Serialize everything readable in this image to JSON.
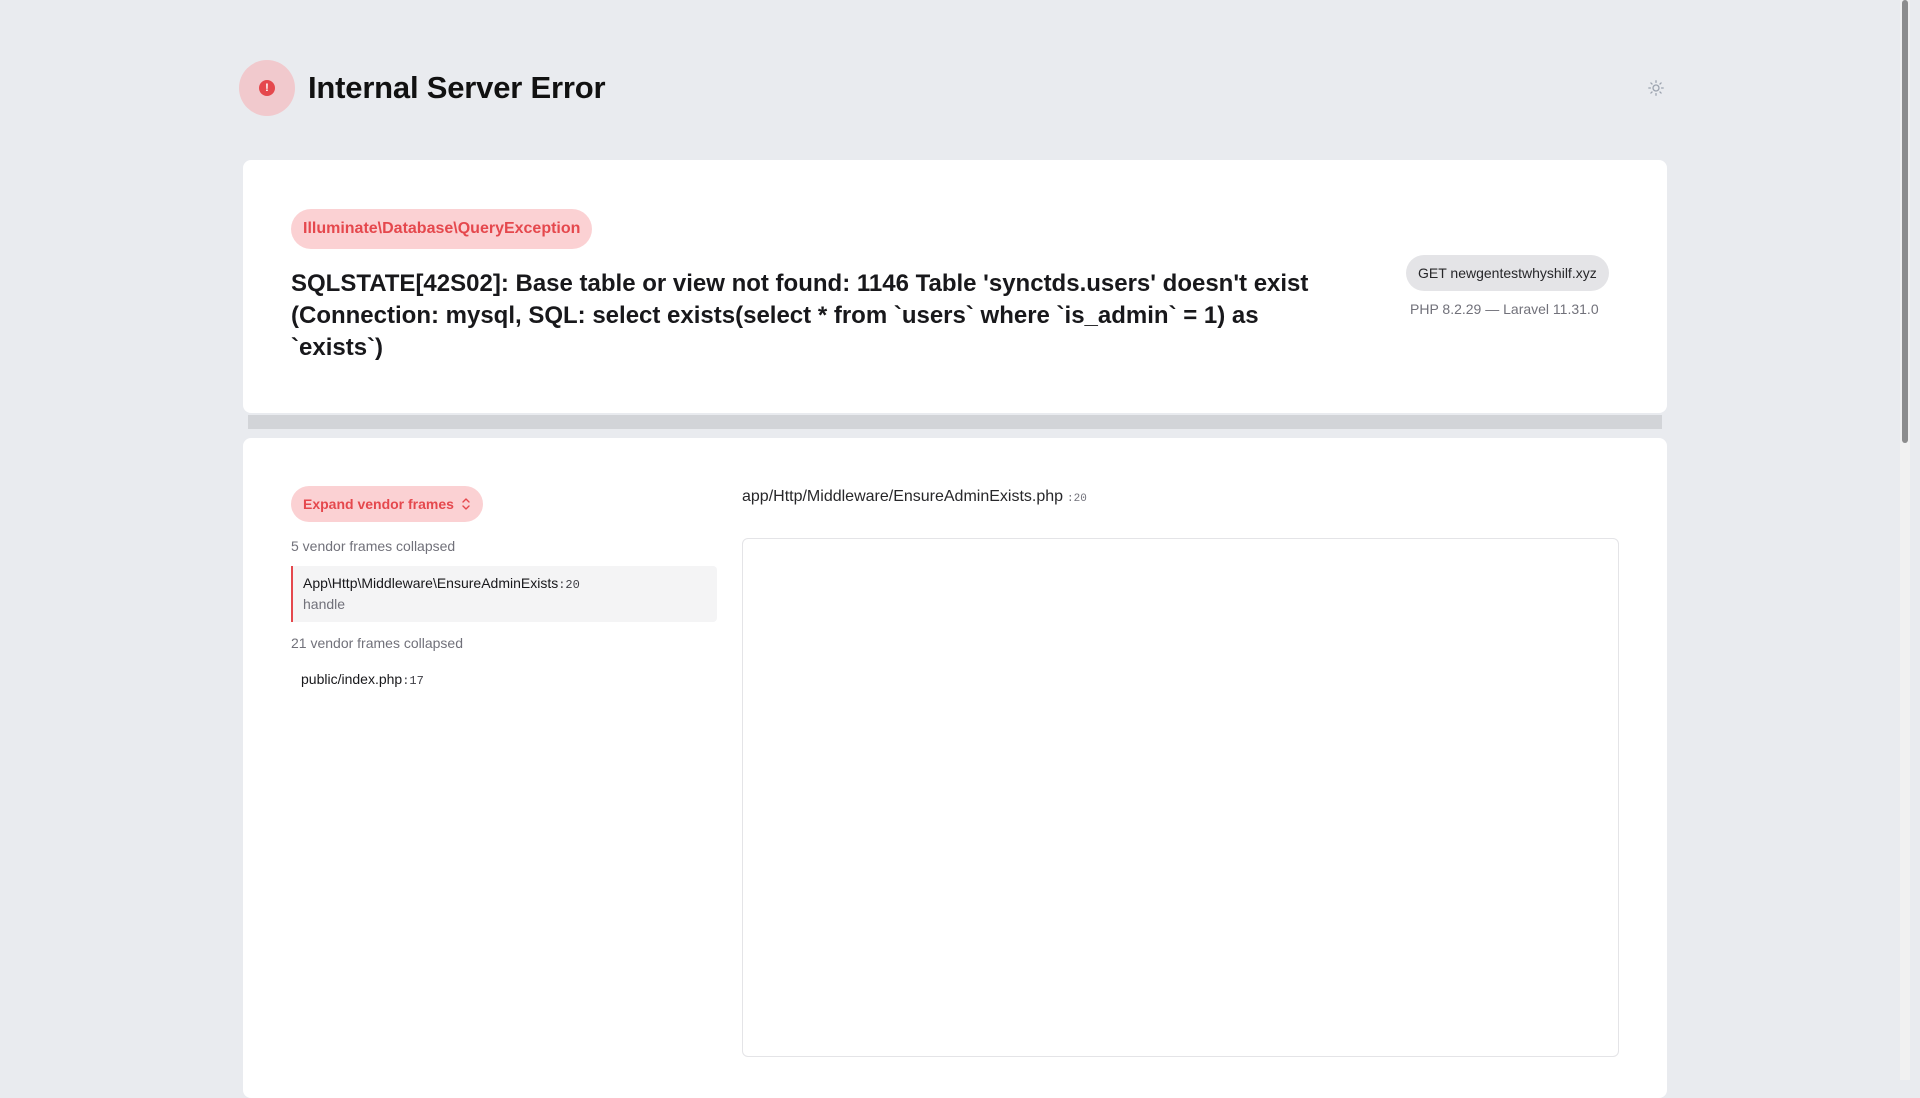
{
  "header": {
    "title": "Internal Server Error",
    "alert_icon_glyph": "!",
    "theme_icon": "sun-icon"
  },
  "error": {
    "exception_class": "Illuminate\\Database\\QueryException",
    "message": "SQLSTATE[42S02]: Base table or view not found: 1146 Table 'synctds.users' doesn't exist (Connection: mysql, SQL: select exists(select * from `users` where `is_admin` = 1) as `exists`)",
    "request": "GET newgentestwhyshilf.xyz",
    "versions": "PHP 8.2.29 — Laravel 11.31.0"
  },
  "trace": {
    "expand_label": "Expand vendor frames",
    "collapsed_top": "5 vendor frames collapsed",
    "active_frame": {
      "class": "App\\Http\\Middleware\\EnsureAdminExists",
      "line": ":20",
      "method": "handle"
    },
    "collapsed_middle": "21 vendor frames collapsed",
    "last_frame": {
      "file": "public/index.php",
      "line": ":17"
    },
    "file_path": "app/Http/Middleware/EnsureAdminExists.php",
    "file_line": ":20"
  },
  "colors": {
    "accent": "#e5484d",
    "accent_soft": "#fbd1d3",
    "background": "#e9ebef",
    "card": "#ffffff"
  }
}
